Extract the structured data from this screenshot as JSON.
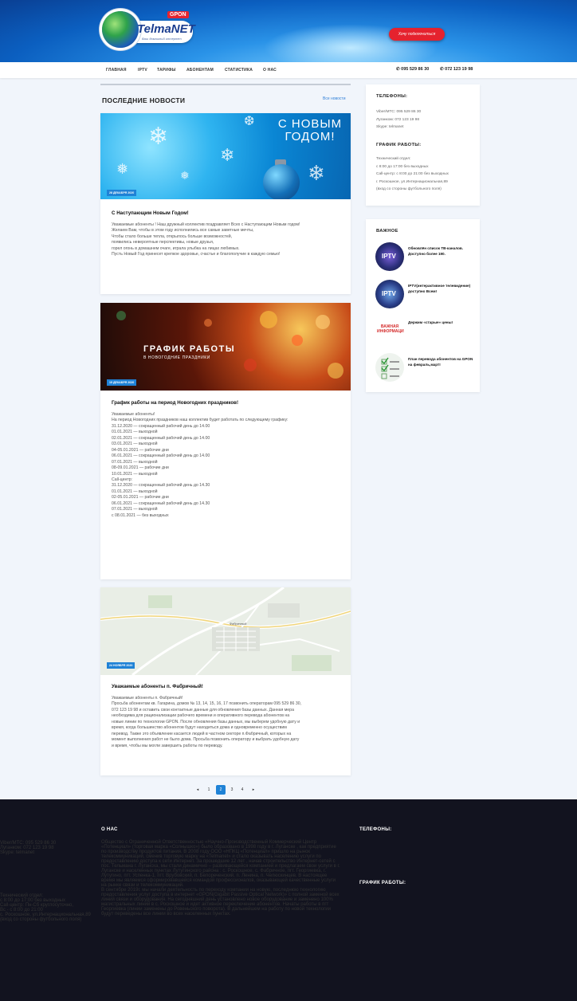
{
  "header": {
    "logo_name": "TelmaNET",
    "logo_badge": "GPON",
    "logo_slogan": "Ваш домашний интернет",
    "connect_label": "Хочу подключиться"
  },
  "nav": {
    "items": [
      "ГЛАВНАЯ",
      "IPTV",
      "ТАРИФЫ",
      "АБОНЕНТАМ",
      "СТАТИСТИКА",
      "О НАС"
    ],
    "phone1": "095 529 86 30",
    "phone2": "072 123 19 98"
  },
  "news": {
    "title": "ПОСЛЕДНИЕ НОВОСТИ",
    "all_link": "Все новости",
    "cards": [
      {
        "image_text": "С НОВЫМ ГОДОМ!",
        "date": "28 ДЕКАБРЯ 2020",
        "title": "С Наступающим Новым Годом!",
        "lines": [
          "Уважаемые абоненты ! Наш дружный коллектив поздравляет Всех с Наступающим  Новым годом!",
          "Желаем Вам, чтобы в этом году исполнились все самые заветные мечты,",
          "Чтобы стало больше тепла, открылось больше возможностей,",
          "появились невероятные перспективы, новые друзья,",
          "горел огонь в домашнем очаге, играла улыбка на лицах любимых.",
          "Пусть Новый Год принесет крепкое здоровье, счастье и благополучие в каждую семью!"
        ]
      },
      {
        "image_title": "ГРАФИК РАБОТЫ",
        "image_sub": "В НОВОГОДНИЕ ПРАЗДНИКИ",
        "date": "15 ДЕКАБРЯ 2020",
        "title": "График работы на период Новогодних праздников!",
        "lines": [
          "Уважаемые абоненты!",
          "На период Новогодних праздников наш коллектив будет работать по следующему графику:",
          "31.12.2020 — сокращенный рабочий день до 14.00",
          "01.01.2021 — выходной",
          "02.01.2021 — сокращенный рабочий день до 14.00",
          "03.01.2021 — выходной",
          "04-05.01.2021 — рабочие дни",
          "06.01.2021 — сокращенный рабочий день до 14.00",
          "07.01.2021 — выходной",
          "08-09.01.2021 — рабочие дни",
          "10.01.2021 — выходной",
          "Call-центр:",
          "31.12.2020 — сокращенный рабочий день до 14.30",
          "01.01.2021 — выходной",
          "02-05.01.2021 — рабочие дни",
          "06.01.2021 — сокращенный рабочий день до 14.30",
          "07.01.2021 — выходной",
          "с 08.01.2021 — без выходных"
        ]
      },
      {
        "date": "24 НОЯБРЯ 2020",
        "map_label": "Фабричный",
        "title": "Уважаемые абоненты п. Фабричный!",
        "lines": [
          "Уважаемые абоненты п. Фабричный!",
          "Просьба абонентам кв. Гагарина, домов № 13, 14, 15, 16, 17 позвонить операторам 095 529 86 30,",
          "072 123 19 98 и оставить свои контактные данные для обновления базы данных. Данная мера",
          "необходима для рационализации рабочего времени и оперативного перевода абонентов на",
          "новые линии по технологии GPON. После обновления базы данных, мы  выберем удобную дату и",
          "время, когда большинство абонентов будут находиться дома и одновременно осуществим",
          "перевод. Также это объявление касается людей в частном секторе  п.Фабричный, которых на",
          "момент выполнения работ не было дома.  Просьба позвонить оператору и выбрать удобную дату",
          "и время, чтобы мы могли завершить работы по переводу."
        ]
      }
    ]
  },
  "sidebar": {
    "phones_title": "ТЕЛЕФОНЫ:",
    "phones": [
      "Viber/МТС: 095 529 86 30",
      "Луганком: 072 123 19 98",
      "Skype: telmanet"
    ],
    "schedule_title": "ГРАФИК РАБОТЫ:",
    "schedule": [
      "Технический отдел:",
      "с 8:00 до 17:00 без выходных",
      "Call-центр: с 8:00 до 21:00 без выходных",
      "г. Роскошное, ул.Интернациональная,89",
      "(вход со стороны футбольного поля)"
    ],
    "important_title": "ВАЖНОЕ",
    "important": [
      {
        "text": "Обновлён список ТВ-каналов. Доступно более 190.",
        "thumb": "IPTV"
      },
      {
        "text": "IPTV(интерактивное телевидение) доступно Всем!",
        "thumb": "IPTV"
      },
      {
        "text": "Держим «старые» цены!",
        "thumb": "ВАЖНАЯ ИНФОРМАЦИЯ"
      },
      {
        "text": "План перевода абонентов на GPON на февраль,март!",
        "thumb": "checklist"
      }
    ]
  },
  "pagination": {
    "prev": "◂",
    "pages": [
      "1",
      "2",
      "3",
      "4"
    ],
    "next": "▸",
    "active": "2"
  },
  "footer": {
    "about_title": "О НАС",
    "about_lines": [
      "Общество с Ограниченной Ответственностью «Научно-Производственный Коммерческий Центр",
      "«Потенциал» (торговая марка «Солнышко») было образовано в 1998 году в г. Луганске , как предприятие",
      "по производству продуктов питания. В 2008 году ООО «НПКЦ «Потенциал» пришло на рынок",
      "телекоммуникаций, сменив торговую марку на «Telmanet» и стало оказывать населению услуги по",
      "предоставлению доступа к сети Интернет. За прошедшие 12 лет , начав строительство Интернет-сетей с",
      "пос. Тельмана г. Луганска, мы стали динамично – развивающейся компанией и предлагаем свои услуги в г.",
      "Луганске и населенных пунктах Лутугинского района : с. Роскошное, с. Фабричное, пгт. Георгиевка, г.",
      "Лутугино, пгт. Успенка-1, пгт. Врубовский, п. Белореченский, п. Ленина, п. Челюскинцев. В настоящее",
      "время мы являемся сформировавшейся командой профессионалов, оказывающей качественные услуги",
      "на рынке связи и телекоммуникаций.",
      "В сентябре 2019г. мы начали деятельность по переходу компании на новую, последнюю технологию",
      "предоставления услуг доступа в интернет «GPON(Gigabit Passive Optical Network)» с полной заменой всех",
      "линий связи и оборудования. На сегодняшний день установлено новое оборудование и заменено 100%",
      "магистральных линий в с. Роскошное и идет активное переключение абонентов. Начаты работы в пгт",
      "Георгиевка (линии заменены до Ровеньского поворота). В дальнейшем на работу по новой технологии",
      "будут переведены все линии во всех населенных пунктах."
    ],
    "phones_title": "ТЕЛЕФОНЫ:",
    "phones": [
      "Viber/МТС: 095 529 86 30",
      "Луганком: 072 123 19 98",
      "Skype: telmanet"
    ],
    "schedule_title": "ГРАФИК РАБОТЫ:",
    "schedule": [
      "Технический отдел:",
      "с 8:00 до 17:00 без выходных",
      "Call-центр: Пн-Сб круглосуточно,",
      "Вс - с 8:00 до 21:00",
      "с. Роскошное, ул.Интернациональная,89",
      "(вход со стороны футбольного поля)"
    ]
  }
}
